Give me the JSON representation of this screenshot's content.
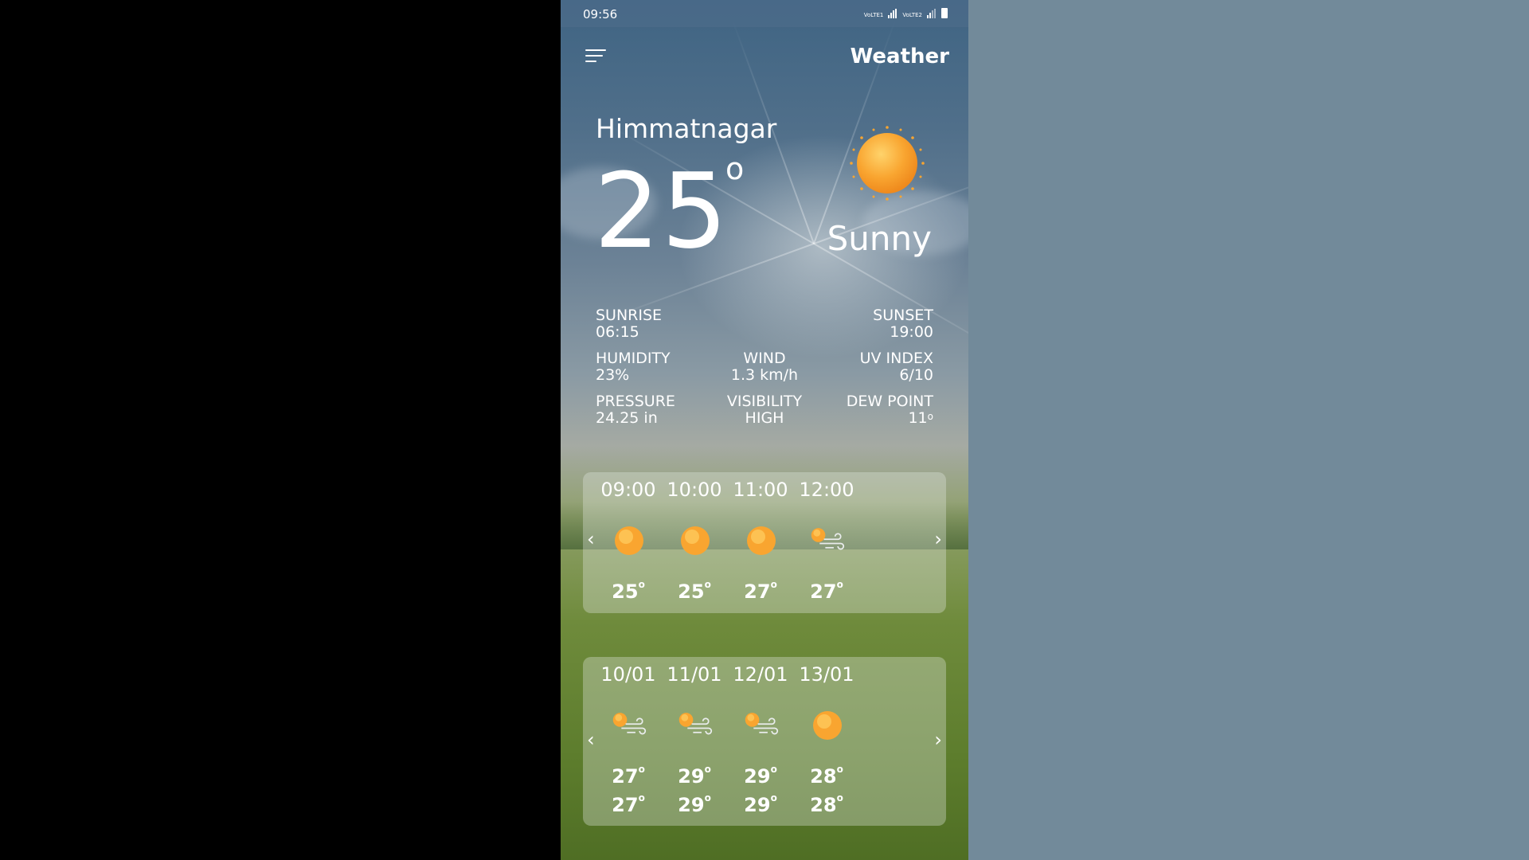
{
  "status_bar": {
    "time": "09:56",
    "network": [
      "VoLTE1",
      "VoLTE2"
    ]
  },
  "header": {
    "title": "Weather",
    "menu_icon": "hamburger-menu-icon"
  },
  "current": {
    "city": "Himmatnagar",
    "temperature": "25",
    "degree_symbol": "o",
    "condition": "Sunny",
    "condition_icon": "sun-icon"
  },
  "details": {
    "sunrise": {
      "label": "SUNRISE",
      "value": "06:15"
    },
    "sunset": {
      "label": "SUNSET",
      "value": "19:00"
    },
    "humidity": {
      "label": "HUMIDITY",
      "value": "23%"
    },
    "wind": {
      "label": "WIND",
      "value": "1.3 km/h"
    },
    "uv_index": {
      "label": "UV INDEX",
      "value": "6/10"
    },
    "pressure": {
      "label": "PRESSURE",
      "value": "24.25 in"
    },
    "visibility": {
      "label": "VISIBILITY",
      "value": "HIGH"
    },
    "dew_point": {
      "label": "DEW POINT",
      "value": "11",
      "unit": "o"
    }
  },
  "hourly": [
    {
      "time": "09:00",
      "icon": "sun-icon",
      "temp": "25",
      "unit": "o"
    },
    {
      "time": "10:00",
      "icon": "sun-icon",
      "temp": "25",
      "unit": "o"
    },
    {
      "time": "11:00",
      "icon": "sun-icon",
      "temp": "27",
      "unit": "o"
    },
    {
      "time": "12:00",
      "icon": "sun-wind-icon",
      "temp": "27",
      "unit": "o"
    }
  ],
  "daily": [
    {
      "date": "10/01",
      "icon": "sun-wind-icon",
      "high": "27",
      "low": "27",
      "unit": "o"
    },
    {
      "date": "11/01",
      "icon": "sun-wind-icon",
      "high": "29",
      "low": "29",
      "unit": "o"
    },
    {
      "date": "12/01",
      "icon": "sun-wind-icon",
      "high": "29",
      "low": "29",
      "unit": "o"
    },
    {
      "date": "13/01",
      "icon": "sun-icon",
      "high": "28",
      "low": "28",
      "unit": "o"
    }
  ],
  "nav": {
    "prev": "‹",
    "next": "›"
  },
  "colors": {
    "sun": "#f7a531",
    "card": "#e1e8e1",
    "sidebar_right": "#728a9a"
  }
}
